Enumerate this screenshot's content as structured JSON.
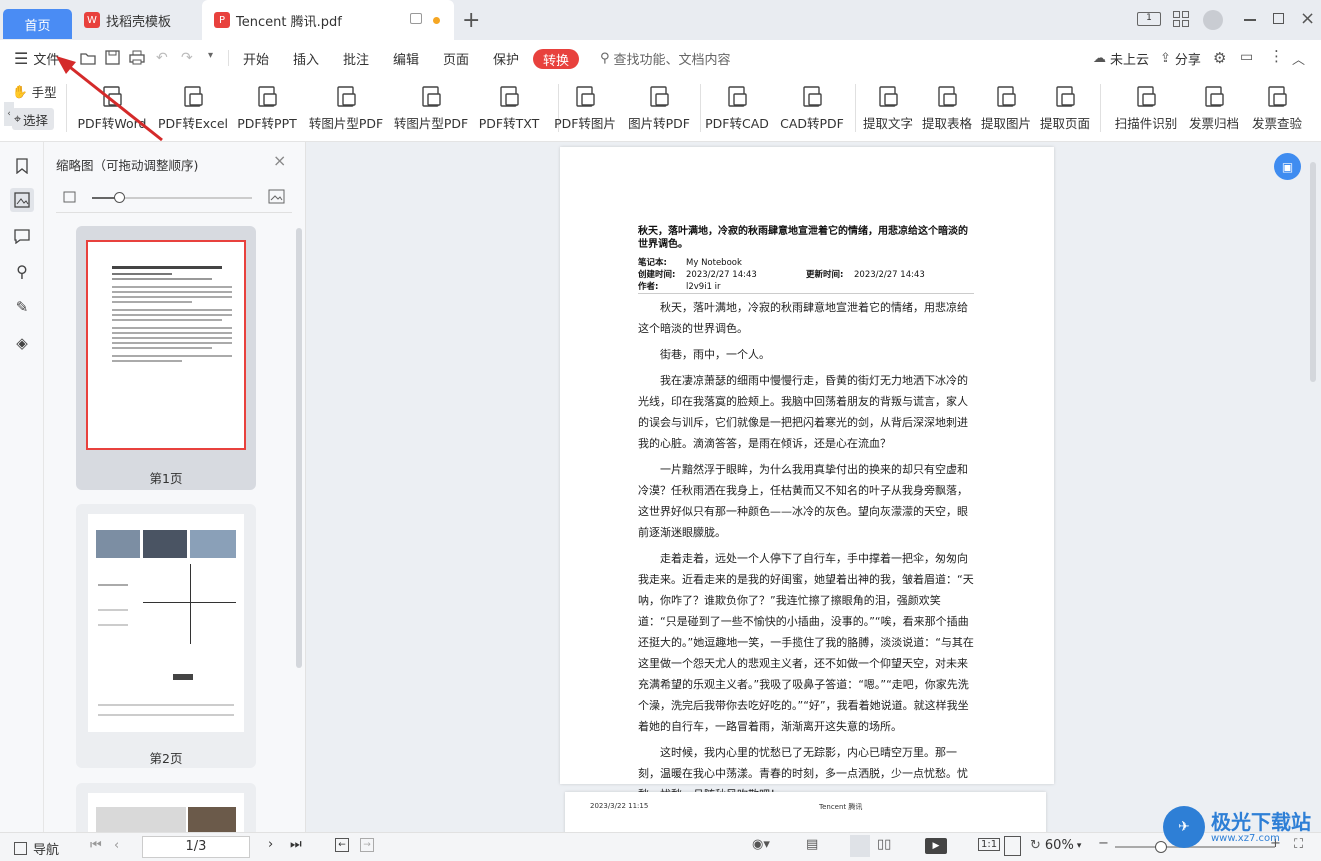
{
  "tabs": {
    "home": "首页",
    "template": "找稻壳模板",
    "doc": "Tencent 腾讯.pdf"
  },
  "menubar": {
    "file": "文件",
    "menus": [
      "开始",
      "插入",
      "批注",
      "编辑",
      "页面",
      "保护"
    ],
    "active_menu": "转换",
    "search_placeholder": "查找功能、文档内容",
    "cloud": "未上云",
    "share": "分享"
  },
  "toolbar": {
    "hand": "手型",
    "select": "选择",
    "tools": [
      "PDF转Word",
      "PDF转Excel",
      "PDF转PPT",
      "转图片型PDF",
      "转图片型PDF",
      "PDF转TXT",
      "PDF转图片",
      "图片转PDF",
      "PDF转CAD",
      "CAD转PDF",
      "提取文字",
      "提取表格",
      "提取图片",
      "提取页面",
      "扫描件识别",
      "发票归档",
      "发票查验"
    ]
  },
  "thumbpanel": {
    "title": "缩略图（可拖动调整顺序)",
    "page1_label": "第1页",
    "page2_label": "第2页"
  },
  "document": {
    "title": "秋天，落叶满地，冷寂的秋雨肆意地宣泄着它的情绪，用悲凉给这个暗淡的世界调色。",
    "meta": {
      "notebook_label": "笔记本:",
      "notebook": "My Notebook",
      "created_label": "创建时间:",
      "created": "2023/2/27 14:43",
      "updated_label": "更新时间:",
      "updated": "2023/2/27 14:43",
      "author_label": "作者:",
      "author": "l2v9i1 ir"
    },
    "paragraphs": [
      "秋天，落叶满地，冷寂的秋雨肆意地宣泄着它的情绪，用悲凉给这个暗淡的世界调色。",
      "街巷，雨中，一个人。",
      "我在凄凉萧瑟的细雨中慢慢行走，昏黄的街灯无力地洒下冰冷的光线，印在我落寞的脸颊上。我脑中回荡着朋友的背叛与谎言，家人的误会与训斥，它们就像是一把把闪着寒光的剑，从背后深深地刺进我的心脏。滴滴答答，是雨在倾诉，还是心在流血？",
      "一片黯然浮于眼眸，为什么我用真挚付出的换来的却只有空虚和冷漠？任秋雨洒在我身上，任枯黄而又不知名的叶子从我身旁飘落，这世界好似只有那一种颜色——冰冷的灰色。望向灰濛濛的天空，眼前逐渐迷眼朦胧。",
      "走着走着，远处一个人停下了自行车，手中撑着一把伞，匆匆向我走来。近看走来的是我的好闺蜜，她望着出神的我，皱着眉道：“天呐，你咋了？谁欺负你了？”我连忙擦了擦眼角的泪，强颜欢笑道：“只是碰到了一些不愉快的小插曲，没事的。”“唉，看来那个插曲还挺大的。”她逗趣地一笑，一手揽住了我的胳膊，淡淡说道：“与其在这里做一个怨天尤人的悲观主义者，还不如做一个仰望天空，对未来充满希望的乐观主义者。”我吸了吸鼻子答道：“嗯。”“走吧，你家先洗个澡，洗完后我带你去吃好吃的。”“好”，我看着她说道。就这样我坐着她的自行车，一路冒着雨，渐渐离开这失意的场所。",
      "这时候，我内心里的忧愁已了无踪影，内心已晴空万里。那一刻，温暖在我心中荡漾。青春的时刻，多一点洒脱，少一点忧愁。忧愁，忧愁，且随秋风吹散吧！"
    ],
    "page2_date": "2023/3/22 11:15",
    "page2_title": "Tencent 腾讯"
  },
  "statusbar": {
    "nav": "导航",
    "page": "1/3",
    "zoom": "60%"
  },
  "watermark": "极光下载站",
  "watermark_url": "www.xz7.com",
  "colors": {
    "accent": "#4a8cf4",
    "convert_active": "#e8413d",
    "arrow": "#d42a2a"
  }
}
